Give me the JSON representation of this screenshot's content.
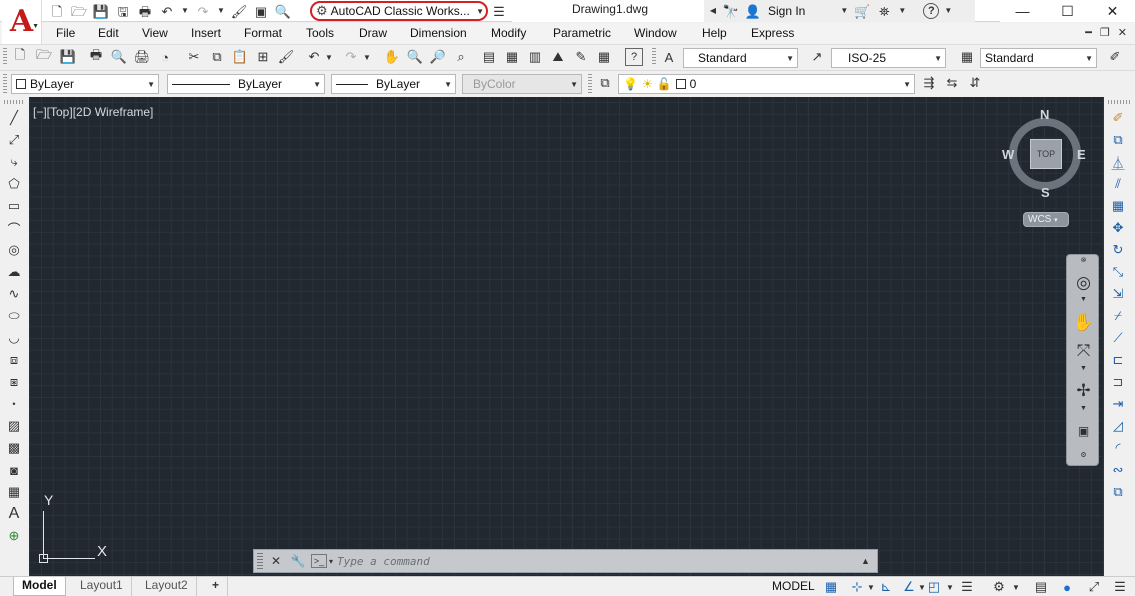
{
  "title_bar": {
    "workspace": "AutoCAD Classic Works...",
    "document_title": "Drawing1.dwg",
    "sign_in": "Sign In",
    "help": "?"
  },
  "menubar": {
    "items": [
      "File",
      "Edit",
      "View",
      "Insert",
      "Format",
      "Tools",
      "Draw",
      "Dimension",
      "Modify",
      "Parametric",
      "Window",
      "Help",
      "Express"
    ]
  },
  "styles_toolbar": {
    "text_style": "Standard",
    "dim_style": "ISO-25",
    "table_style": "Standard"
  },
  "properties_toolbar": {
    "color": "ByLayer",
    "linetype": "ByLayer",
    "lineweight": "ByLayer",
    "plot_style": "ByColor",
    "layer": "0"
  },
  "viewport": {
    "label": "[−][Top][2D Wireframe]"
  },
  "viewcube": {
    "face": "TOP",
    "north": "N",
    "south": "S",
    "east": "E",
    "west": "W",
    "coord_system": "WCS"
  },
  "ucs": {
    "x": "X",
    "y": "Y"
  },
  "command_line": {
    "placeholder": "Type a command"
  },
  "status_bar": {
    "tabs": [
      "Model",
      "Layout1",
      "Layout2"
    ],
    "add_tab": "+",
    "space": "MODEL"
  },
  "colors": {
    "canvas": "#212830",
    "accent_red": "#c41b1b",
    "workspace_highlight": "#d42020"
  }
}
